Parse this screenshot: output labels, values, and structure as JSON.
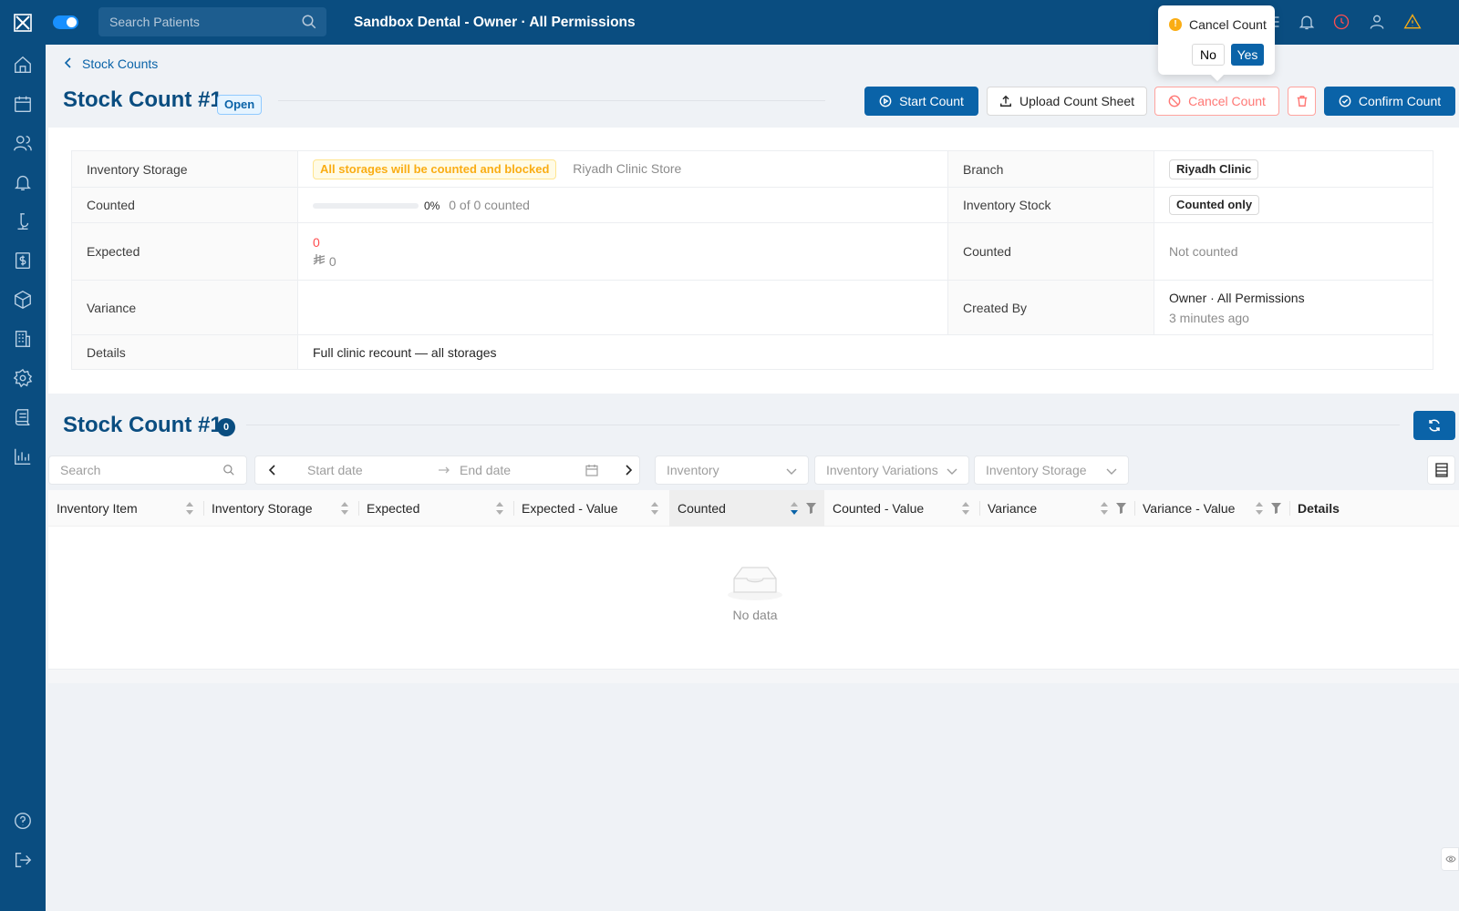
{
  "topbar": {
    "search_placeholder": "Search Patients",
    "title": "Sandbox Dental - Owner · All Permissions"
  },
  "popconfirm": {
    "title": "Cancel Count",
    "no": "No",
    "yes": "Yes"
  },
  "breadcrumb": {
    "label": "Stock Counts"
  },
  "header": {
    "title": "Stock Count #1",
    "status": "Open",
    "buttons": {
      "start": "Start Count",
      "upload": "Upload Count Sheet",
      "cancel": "Cancel Count",
      "confirm": "Confirm Count"
    }
  },
  "details": {
    "inventory_storage_label": "Inventory Storage",
    "storage_warning": "All storages will be counted and blocked",
    "storage_name": "Riyadh Clinic Store",
    "branch_label": "Branch",
    "branch_value": "Riyadh Clinic",
    "counted_label": "Counted",
    "progress_percent": "0%",
    "progress_fraction": 0,
    "progress_text": "0 of 0 counted",
    "inventory_stock_label": "Inventory Stock",
    "inventory_stock_value": "Counted only",
    "expected_label": "Expected",
    "expected_value": "0",
    "expected_amount": "0",
    "counted2_label": "Counted",
    "counted2_value": "Not counted",
    "variance_label": "Variance",
    "created_by_label": "Created By",
    "created_by_name": "Owner · All Permissions",
    "created_by_time": "3 minutes ago",
    "details_label": "Details",
    "details_value": "Full clinic recount — all storages"
  },
  "table_section": {
    "title": "Stock Count #1",
    "count": "0",
    "search_placeholder": "Search",
    "start_date": "Start date",
    "end_date": "End date",
    "filter_inventory": "Inventory",
    "filter_variations": "Inventory Variations",
    "filter_storage": "Inventory Storage",
    "columns": [
      "Inventory Item",
      "Inventory Storage",
      "Expected",
      "Expected - Value",
      "Counted",
      "Counted - Value",
      "Variance",
      "Variance - Value",
      "Details"
    ],
    "empty_text": "No data"
  },
  "colors": {
    "brand": "#0a4d80",
    "primary": "#0a63a8",
    "warning": "#faad14",
    "danger": "#ff4d4f"
  }
}
